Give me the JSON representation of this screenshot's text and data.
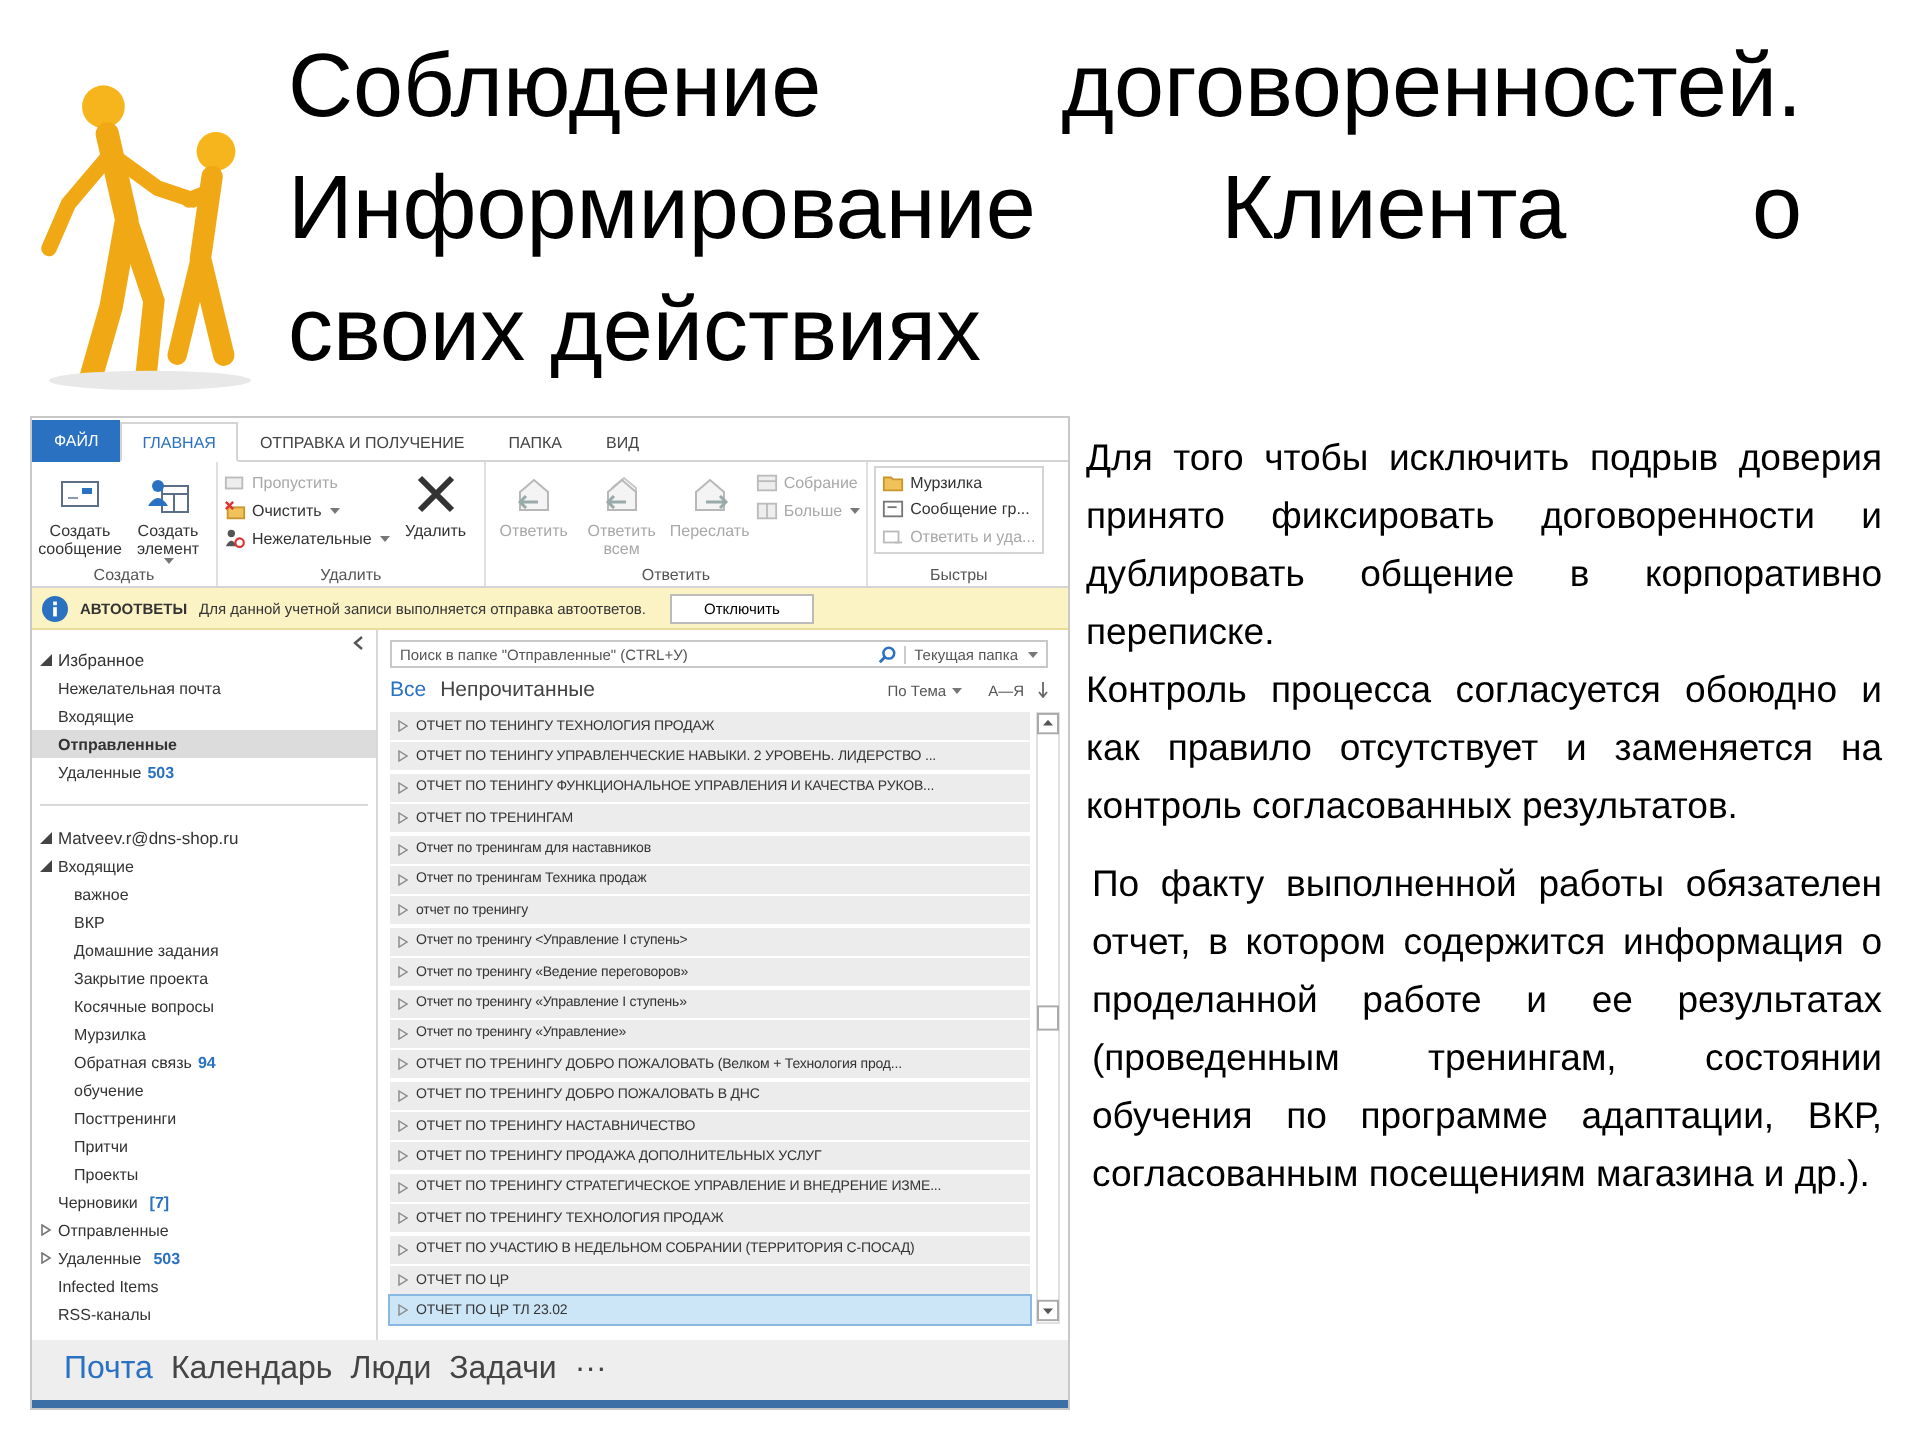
{
  "title_lines": [
    "Соблюдение договоренностей.",
    "Информирование Клиента о",
    "своих действиях"
  ],
  "outlook": {
    "tabs": [
      {
        "label": "ФАЙЛ",
        "kind": "file",
        "selected": false
      },
      {
        "label": "ГЛАВНАЯ",
        "kind": "tab",
        "selected": true
      },
      {
        "label": "ОТПРАВКА И ПОЛУЧЕНИЕ",
        "kind": "tab",
        "selected": false
      },
      {
        "label": "ПАПКА",
        "kind": "tab",
        "selected": false
      },
      {
        "label": "ВИД",
        "kind": "tab",
        "selected": false
      }
    ],
    "ribbon_groups": [
      {
        "label": "Создать",
        "items": [
          {
            "kind": "large",
            "label": "Создать сообщение",
            "dropdown": false,
            "disabled": false
          },
          {
            "kind": "large",
            "label": "Создать элемент",
            "dropdown": true,
            "disabled": false
          }
        ]
      },
      {
        "label": "Удалить",
        "items": [
          {
            "kind": "stack",
            "buttons": [
              {
                "label": "Пропустить",
                "dropdown": false,
                "disabled": true
              },
              {
                "label": "Очистить",
                "dropdown": true,
                "disabled": false
              },
              {
                "label": "Нежелательные",
                "dropdown": true,
                "disabled": false
              }
            ]
          },
          {
            "kind": "large",
            "label": "Удалить",
            "dropdown": false,
            "disabled": false
          }
        ]
      },
      {
        "label": "Ответить",
        "items": [
          {
            "kind": "large",
            "label": "Ответить",
            "dropdown": false,
            "disabled": true
          },
          {
            "kind": "large",
            "label": "Ответить всем",
            "dropdown": false,
            "disabled": true
          },
          {
            "kind": "large",
            "label": "Переслать",
            "dropdown": false,
            "disabled": true
          },
          {
            "kind": "stack",
            "buttons": [
              {
                "label": "Собрание",
                "dropdown": false,
                "disabled": true
              },
              {
                "label": "Больше",
                "dropdown": true,
                "disabled": true
              }
            ]
          }
        ]
      },
      {
        "label": "Быстры",
        "items": [
          {
            "kind": "gallery",
            "buttons": [
              {
                "label": "Мурзилка",
                "dropdown": false,
                "disabled": false
              },
              {
                "label": "Сообщение гр...",
                "dropdown": false,
                "disabled": false
              },
              {
                "label": "Ответить и уда...",
                "dropdown": false,
                "disabled": true
              }
            ]
          }
        ]
      }
    ],
    "infobar": {
      "title": "АВТООТВЕТЫ",
      "message": "Для данной учетной записи выполняется отправка автоответов.",
      "button": "Отключить"
    },
    "favorites": {
      "label": "Избранное",
      "expanded": true,
      "items": [
        {
          "label": "Нежелательная почта",
          "selected": false
        },
        {
          "label": "Входящие",
          "selected": false
        },
        {
          "label": "Отправленные",
          "selected": true
        },
        {
          "label": "Удаленные",
          "count": "503",
          "selected": false
        }
      ]
    },
    "account": {
      "label": "Matveev.r@dns-shop.ru",
      "expanded": true,
      "folders": [
        {
          "label": "Входящие",
          "expanded": true,
          "selected": false,
          "children": [
            {
              "label": "важное",
              "selected": false
            },
            {
              "label": "ВКР",
              "selected": false
            },
            {
              "label": "Домашние задания",
              "selected": false
            },
            {
              "label": "Закрытие проекта",
              "selected": false
            },
            {
              "label": "Косячные вопросы",
              "selected": false
            },
            {
              "label": "Мурзилка",
              "selected": false
            },
            {
              "label": "Обратная связь",
              "count": "94",
              "selected": false
            },
            {
              "label": "обучение",
              "selected": false
            },
            {
              "label": "Посттренинги",
              "selected": false
            },
            {
              "label": "Притчи",
              "selected": false
            },
            {
              "label": "Проекты",
              "selected": false
            }
          ]
        },
        {
          "label": "Черновики",
          "count": "[7]",
          "selected": false
        },
        {
          "label": "Отправленные",
          "expanded": false,
          "selected": false
        },
        {
          "label": "Удаленные",
          "count": "503",
          "expanded": false,
          "selected": false
        },
        {
          "label": "Infected Items",
          "selected": false
        },
        {
          "label": "RSS-каналы",
          "selected": false
        }
      ]
    },
    "search": {
      "placeholder": "Поиск в папке \"Отправленные\" (CTRL+У)",
      "scope": "Текущая папка"
    },
    "filters": [
      {
        "label": "Все",
        "selected": true
      },
      {
        "label": "Непрочитанные",
        "selected": false
      }
    ],
    "sort": {
      "by": "По Тема",
      "order": "А—Я"
    },
    "rows": [
      {
        "subject": "ОТЧЕТ ПО ТЕНИНГУ ТЕХНОЛОГИЯ ПРОДАЖ",
        "selected": false
      },
      {
        "subject": "ОТЧЕТ ПО ТЕНИНГУ УПРАВЛЕНЧЕСКИЕ НАВЫКИ. 2 УРОВЕНЬ. ЛИДЕРСТВО ...",
        "selected": false
      },
      {
        "subject": "ОТЧЕТ ПО ТЕНИНГУ ФУНКЦИОНАЛЬНОЕ УПРАВЛЕНИЯ И КАЧЕСТВА РУКОВ...",
        "selected": false
      },
      {
        "subject": "ОТЧЕТ ПО ТРЕНИНГАМ",
        "selected": false
      },
      {
        "subject": "Отчет по тренингам для наставников",
        "selected": false
      },
      {
        "subject": "Отчет по тренингам Техника продаж",
        "selected": false
      },
      {
        "subject": "отчет по тренингу",
        "selected": false
      },
      {
        "subject": "Отчет по тренингу <Управление I ступень>",
        "selected": false
      },
      {
        "subject": "Отчет по тренингу «Ведение переговоров»",
        "selected": false
      },
      {
        "subject": "Отчет по тренингу «Управление I ступень»",
        "selected": false
      },
      {
        "subject": "Отчет по тренингу «Управление»",
        "selected": false
      },
      {
        "subject": "ОТЧЕТ ПО ТРЕНИНГУ ДОБРО ПОЖАЛОВАТЬ (Велком + Технология прод...",
        "selected": false
      },
      {
        "subject": "ОТЧЕТ ПО ТРЕНИНГУ ДОБРО ПОЖАЛОВАТЬ В ДНС",
        "selected": false
      },
      {
        "subject": "ОТЧЕТ ПО ТРЕНИНГУ НАСТАВНИЧЕСТВО",
        "selected": false
      },
      {
        "subject": "ОТЧЕТ ПО ТРЕНИНГУ ПРОДАЖА ДОПОЛНИТЕЛЬНЫХ УСЛУГ",
        "selected": false
      },
      {
        "subject": "ОТЧЕТ ПО ТРЕНИНГУ СТРАТЕГИЧЕСКОЕ УПРАВЛЕНИЕ И ВНЕДРЕНИЕ ИЗМЕ...",
        "selected": false
      },
      {
        "subject": "ОТЧЕТ ПО ТРЕНИНГУ ТЕХНОЛОГИЯ ПРОДАЖ",
        "selected": false
      },
      {
        "subject": "ОТЧЕТ ПО УЧАСТИЮ В НЕДЕЛЬНОМ СОБРАНИИ (ТЕРРИТОРИЯ С-ПОСАД)",
        "selected": false
      },
      {
        "subject": "ОТЧЕТ ПО ЦР",
        "selected": false
      },
      {
        "subject": "ОТЧЕТ ПО ЦР ТЛ 23.02",
        "selected": true
      }
    ],
    "nav": [
      {
        "label": "Почта",
        "selected": true
      },
      {
        "label": "Календарь",
        "selected": false
      },
      {
        "label": "Люди",
        "selected": false
      },
      {
        "label": "Задачи",
        "selected": false
      }
    ],
    "nav_more": "···"
  },
  "paragraphs": [
    "Для того чтобы исключить подрыв доверия принято фиксировать договоренности и дублировать общение в корпоративно переписке.",
    "Контроль процесса согласуется обоюдно и как правило отсутствует и заменяется на контроль согласованных результатов.",
    "По факту выполненной работы обязателен отчет, в котором содержится информация о проделанной работе и ее результатах (проведенным тренингам, состоянии обучения по программе адаптации, ВКР, согласованным посещениям магазина и др.)."
  ]
}
